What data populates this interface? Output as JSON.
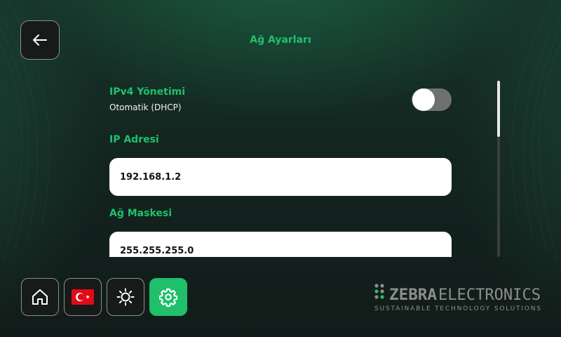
{
  "page": {
    "title": "Ağ Ayarları"
  },
  "ipv4": {
    "label": "IPv4 Yönetimi",
    "mode": "Otomatik (DHCP)",
    "toggle_on": false
  },
  "ip": {
    "label": "IP Adresi",
    "value": "192.168.1.2"
  },
  "mask": {
    "label": "Ağ Maskesi",
    "value": "255.255.255.0"
  },
  "nav": {
    "items": [
      {
        "icon": "home-icon"
      },
      {
        "icon": "turkey-flag-icon"
      },
      {
        "icon": "brightness-icon"
      },
      {
        "icon": "gear-icon",
        "active": true
      }
    ]
  },
  "logo": {
    "name_bold": "ZEBRA",
    "name_light": "ELECTRONICS",
    "tagline": "SUSTAINABLE TECHNOLOGY SOLUTIONS"
  },
  "colors": {
    "accent": "#1fc16b",
    "background": "#131f1c",
    "flag_red": "#e30a17"
  }
}
